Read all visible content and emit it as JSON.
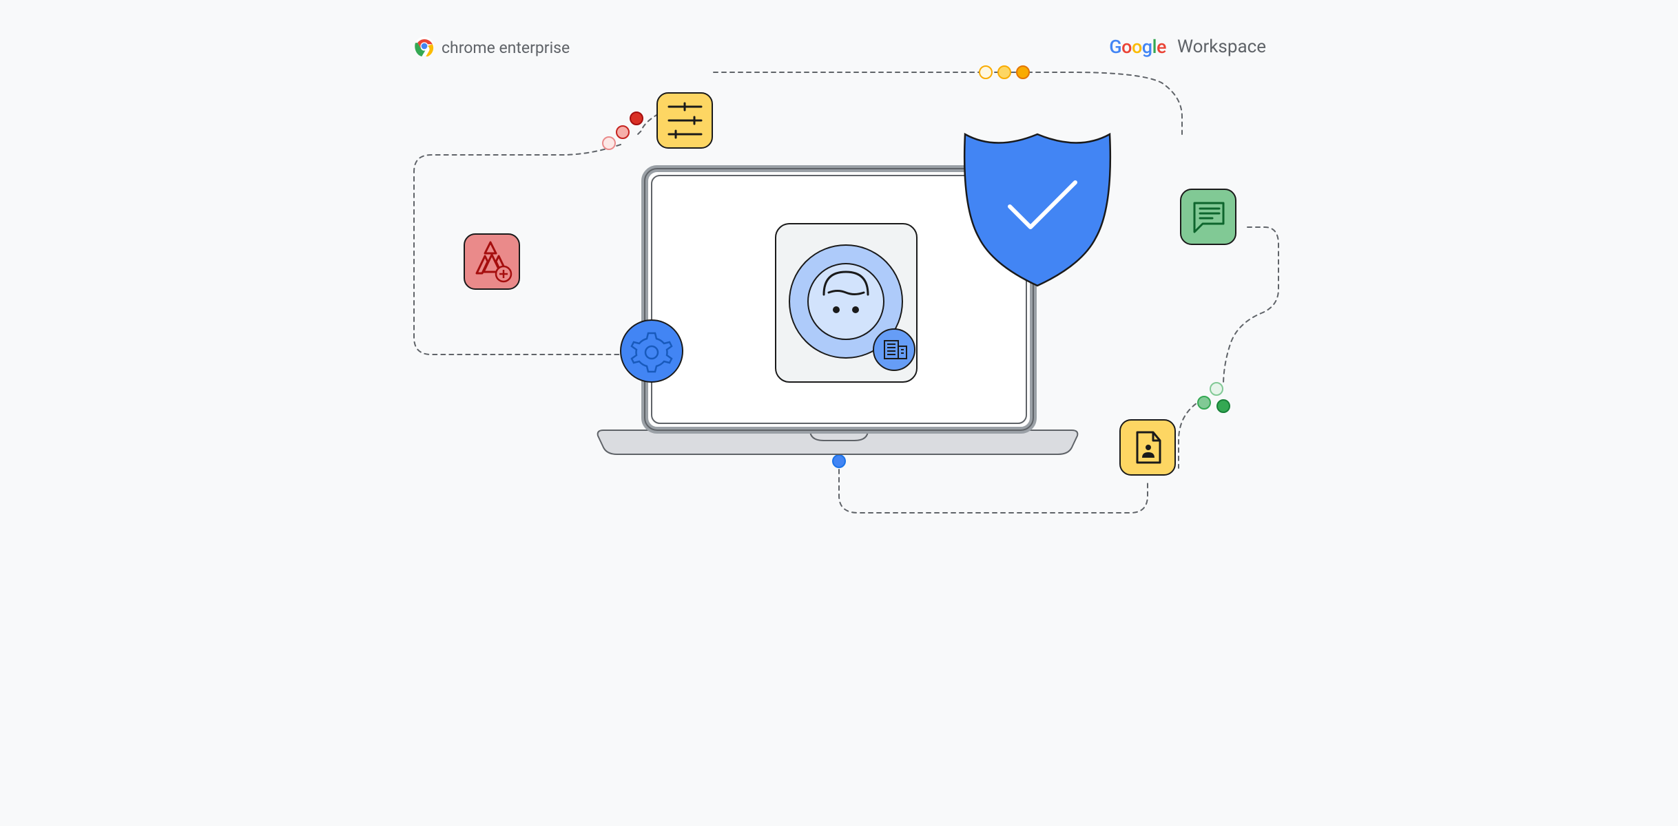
{
  "brands": {
    "chrome_enterprise": "chrome enterprise",
    "google": {
      "g1": "G",
      "o1": "o",
      "o2": "o",
      "g2": "g",
      "l": "l",
      "e": "e"
    },
    "workspace": "Workspace"
  },
  "colors": {
    "bg": "#f8f9fa",
    "stroke": "#1a1a1a",
    "dashed": "#5f6368",
    "blue": "#4285f4",
    "blue_light": "#aecbfa",
    "blue_pale": "#d2e3fc",
    "red": "#ea8a8a",
    "red_dark": "#c5221f",
    "yellow": "#fdd663",
    "yellow_dark": "#f9ab00",
    "green": "#81c995",
    "green_dark": "#34a853",
    "grey": "#9aa0a6",
    "grey_light": "#dadce0",
    "white": "#ffffff"
  },
  "icons": {
    "settings_sliders": "settings-sliders-icon",
    "drive_plus": "drive-plus-icon",
    "chat": "chat-icon",
    "contact_slides": "contact-document-icon",
    "gear": "gear-icon",
    "shield": "shield-check-icon",
    "avatar": "user-avatar-icon",
    "building": "building-icon",
    "chrome": "chrome-icon"
  }
}
